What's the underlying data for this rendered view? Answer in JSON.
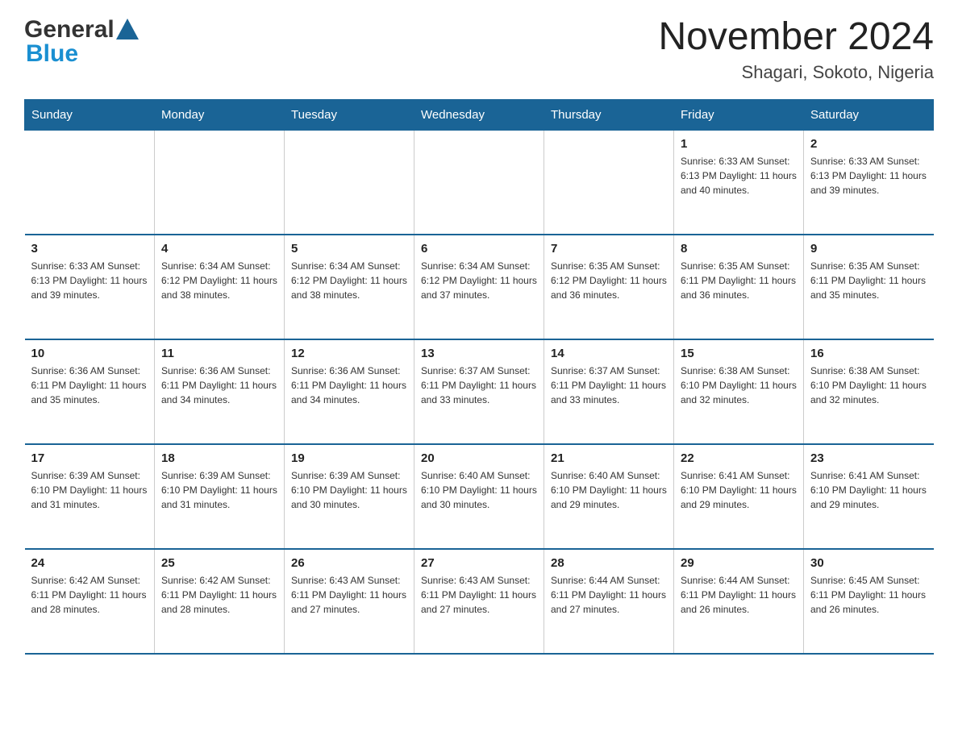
{
  "header": {
    "logo_general": "General",
    "logo_blue": "Blue",
    "month_title": "November 2024",
    "location": "Shagari, Sokoto, Nigeria"
  },
  "weekdays": [
    "Sunday",
    "Monday",
    "Tuesday",
    "Wednesday",
    "Thursday",
    "Friday",
    "Saturday"
  ],
  "weeks": [
    [
      {
        "day": "",
        "info": ""
      },
      {
        "day": "",
        "info": ""
      },
      {
        "day": "",
        "info": ""
      },
      {
        "day": "",
        "info": ""
      },
      {
        "day": "",
        "info": ""
      },
      {
        "day": "1",
        "info": "Sunrise: 6:33 AM\nSunset: 6:13 PM\nDaylight: 11 hours\nand 40 minutes."
      },
      {
        "day": "2",
        "info": "Sunrise: 6:33 AM\nSunset: 6:13 PM\nDaylight: 11 hours\nand 39 minutes."
      }
    ],
    [
      {
        "day": "3",
        "info": "Sunrise: 6:33 AM\nSunset: 6:13 PM\nDaylight: 11 hours\nand 39 minutes."
      },
      {
        "day": "4",
        "info": "Sunrise: 6:34 AM\nSunset: 6:12 PM\nDaylight: 11 hours\nand 38 minutes."
      },
      {
        "day": "5",
        "info": "Sunrise: 6:34 AM\nSunset: 6:12 PM\nDaylight: 11 hours\nand 38 minutes."
      },
      {
        "day": "6",
        "info": "Sunrise: 6:34 AM\nSunset: 6:12 PM\nDaylight: 11 hours\nand 37 minutes."
      },
      {
        "day": "7",
        "info": "Sunrise: 6:35 AM\nSunset: 6:12 PM\nDaylight: 11 hours\nand 36 minutes."
      },
      {
        "day": "8",
        "info": "Sunrise: 6:35 AM\nSunset: 6:11 PM\nDaylight: 11 hours\nand 36 minutes."
      },
      {
        "day": "9",
        "info": "Sunrise: 6:35 AM\nSunset: 6:11 PM\nDaylight: 11 hours\nand 35 minutes."
      }
    ],
    [
      {
        "day": "10",
        "info": "Sunrise: 6:36 AM\nSunset: 6:11 PM\nDaylight: 11 hours\nand 35 minutes."
      },
      {
        "day": "11",
        "info": "Sunrise: 6:36 AM\nSunset: 6:11 PM\nDaylight: 11 hours\nand 34 minutes."
      },
      {
        "day": "12",
        "info": "Sunrise: 6:36 AM\nSunset: 6:11 PM\nDaylight: 11 hours\nand 34 minutes."
      },
      {
        "day": "13",
        "info": "Sunrise: 6:37 AM\nSunset: 6:11 PM\nDaylight: 11 hours\nand 33 minutes."
      },
      {
        "day": "14",
        "info": "Sunrise: 6:37 AM\nSunset: 6:11 PM\nDaylight: 11 hours\nand 33 minutes."
      },
      {
        "day": "15",
        "info": "Sunrise: 6:38 AM\nSunset: 6:10 PM\nDaylight: 11 hours\nand 32 minutes."
      },
      {
        "day": "16",
        "info": "Sunrise: 6:38 AM\nSunset: 6:10 PM\nDaylight: 11 hours\nand 32 minutes."
      }
    ],
    [
      {
        "day": "17",
        "info": "Sunrise: 6:39 AM\nSunset: 6:10 PM\nDaylight: 11 hours\nand 31 minutes."
      },
      {
        "day": "18",
        "info": "Sunrise: 6:39 AM\nSunset: 6:10 PM\nDaylight: 11 hours\nand 31 minutes."
      },
      {
        "day": "19",
        "info": "Sunrise: 6:39 AM\nSunset: 6:10 PM\nDaylight: 11 hours\nand 30 minutes."
      },
      {
        "day": "20",
        "info": "Sunrise: 6:40 AM\nSunset: 6:10 PM\nDaylight: 11 hours\nand 30 minutes."
      },
      {
        "day": "21",
        "info": "Sunrise: 6:40 AM\nSunset: 6:10 PM\nDaylight: 11 hours\nand 29 minutes."
      },
      {
        "day": "22",
        "info": "Sunrise: 6:41 AM\nSunset: 6:10 PM\nDaylight: 11 hours\nand 29 minutes."
      },
      {
        "day": "23",
        "info": "Sunrise: 6:41 AM\nSunset: 6:10 PM\nDaylight: 11 hours\nand 29 minutes."
      }
    ],
    [
      {
        "day": "24",
        "info": "Sunrise: 6:42 AM\nSunset: 6:11 PM\nDaylight: 11 hours\nand 28 minutes."
      },
      {
        "day": "25",
        "info": "Sunrise: 6:42 AM\nSunset: 6:11 PM\nDaylight: 11 hours\nand 28 minutes."
      },
      {
        "day": "26",
        "info": "Sunrise: 6:43 AM\nSunset: 6:11 PM\nDaylight: 11 hours\nand 27 minutes."
      },
      {
        "day": "27",
        "info": "Sunrise: 6:43 AM\nSunset: 6:11 PM\nDaylight: 11 hours\nand 27 minutes."
      },
      {
        "day": "28",
        "info": "Sunrise: 6:44 AM\nSunset: 6:11 PM\nDaylight: 11 hours\nand 27 minutes."
      },
      {
        "day": "29",
        "info": "Sunrise: 6:44 AM\nSunset: 6:11 PM\nDaylight: 11 hours\nand 26 minutes."
      },
      {
        "day": "30",
        "info": "Sunrise: 6:45 AM\nSunset: 6:11 PM\nDaylight: 11 hours\nand 26 minutes."
      }
    ]
  ]
}
